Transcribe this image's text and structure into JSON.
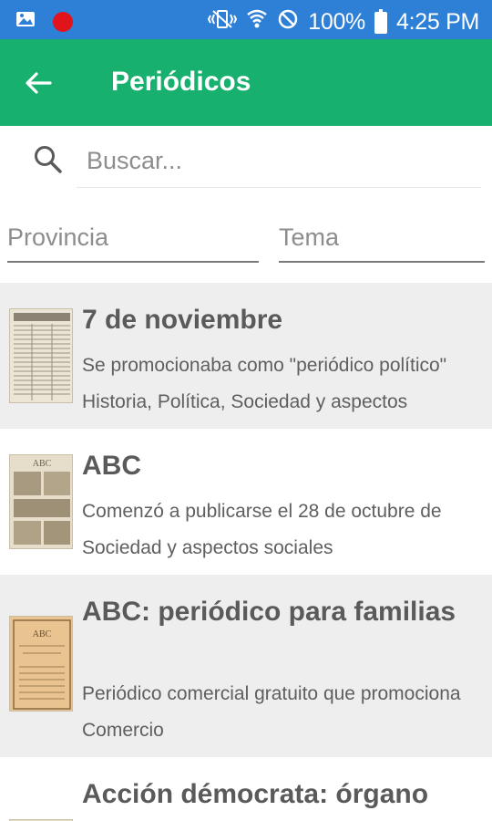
{
  "status_bar": {
    "battery": "100%",
    "time": "4:25 PM",
    "left_icons": [
      "gallery-icon",
      "record-icon"
    ],
    "right_icons": [
      "vibrate-icon",
      "wifi-icon",
      "do-not-disturb-icon",
      "battery-icon"
    ]
  },
  "app_bar": {
    "title": "Periódicos",
    "color": "#17b06e"
  },
  "search": {
    "placeholder": "Buscar...",
    "value": ""
  },
  "filters": {
    "provincia": "Provincia",
    "tema": "Tema"
  },
  "items": [
    {
      "title": "7 de noviembre",
      "description": "Se promocionaba como \"periódico político\"",
      "tags": "Historia, Política, Sociedad y aspectos"
    },
    {
      "title": "ABC",
      "description": "Comenzó a publicarse el 28 de octubre de",
      "tags": "Sociedad y aspectos sociales"
    },
    {
      "title": "ABC: periódico para familias",
      "description": "Periódico comercial gratuito que promociona",
      "tags": "Comercio"
    },
    {
      "title": "Acción démocrata: órgano",
      "description": "",
      "tags": ""
    }
  ],
  "colors": {
    "status_bar": "#2e7fd6",
    "app_bar": "#17b06e",
    "row_shaded": "#eeeeee"
  }
}
